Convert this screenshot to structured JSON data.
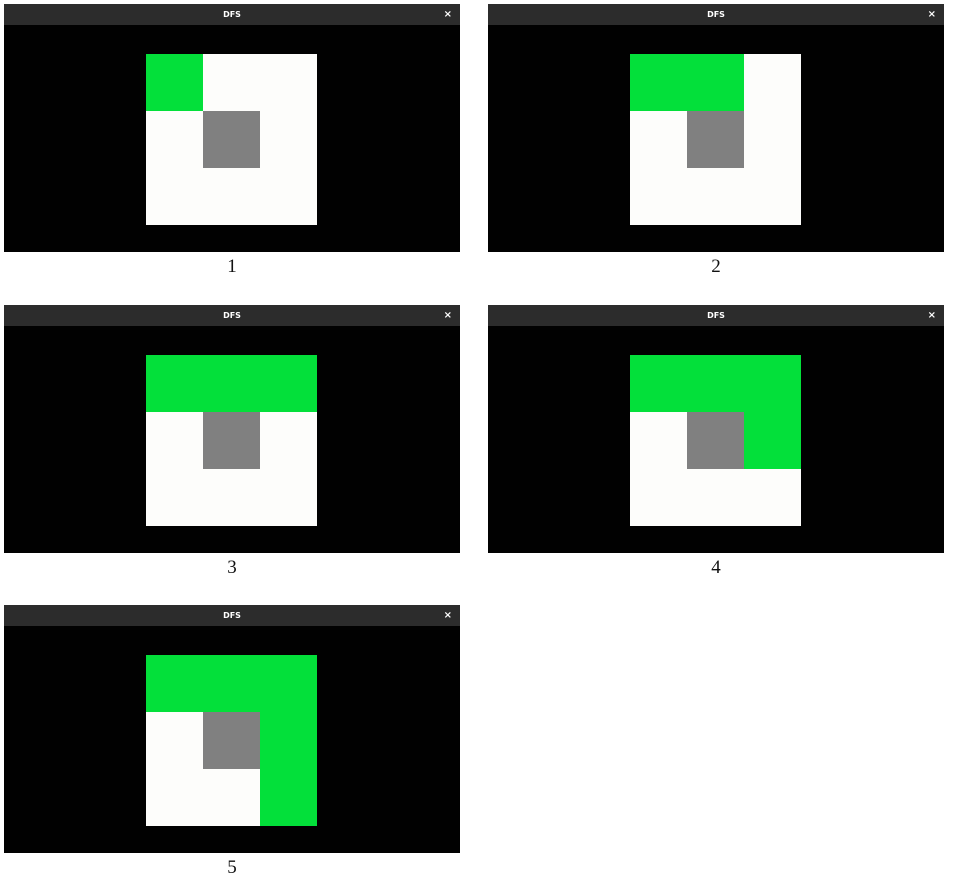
{
  "colors": {
    "open": "#fdfdfb",
    "wall": "#808080",
    "visited": "#03e03a",
    "background": "#010101",
    "titlebar": "#2c2c2c"
  },
  "panels": [
    {
      "window_title": "DFS",
      "close_label": "×",
      "caption": "1",
      "grid": [
        [
          "visited",
          "open",
          "open"
        ],
        [
          "open",
          "wall",
          "open"
        ],
        [
          "open",
          "open",
          "open"
        ]
      ]
    },
    {
      "window_title": "DFS",
      "close_label": "×",
      "caption": "2",
      "grid": [
        [
          "visited",
          "visited",
          "open"
        ],
        [
          "open",
          "wall",
          "open"
        ],
        [
          "open",
          "open",
          "open"
        ]
      ]
    },
    {
      "window_title": "DFS",
      "close_label": "×",
      "caption": "3",
      "grid": [
        [
          "visited",
          "visited",
          "visited"
        ],
        [
          "open",
          "wall",
          "open"
        ],
        [
          "open",
          "open",
          "open"
        ]
      ]
    },
    {
      "window_title": "DFS",
      "close_label": "×",
      "caption": "4",
      "grid": [
        [
          "visited",
          "visited",
          "visited"
        ],
        [
          "open",
          "wall",
          "visited"
        ],
        [
          "open",
          "open",
          "open"
        ]
      ]
    },
    {
      "window_title": "DFS",
      "close_label": "×",
      "caption": "5",
      "grid": [
        [
          "visited",
          "visited",
          "visited"
        ],
        [
          "open",
          "wall",
          "visited"
        ],
        [
          "open",
          "open",
          "visited"
        ]
      ]
    }
  ]
}
